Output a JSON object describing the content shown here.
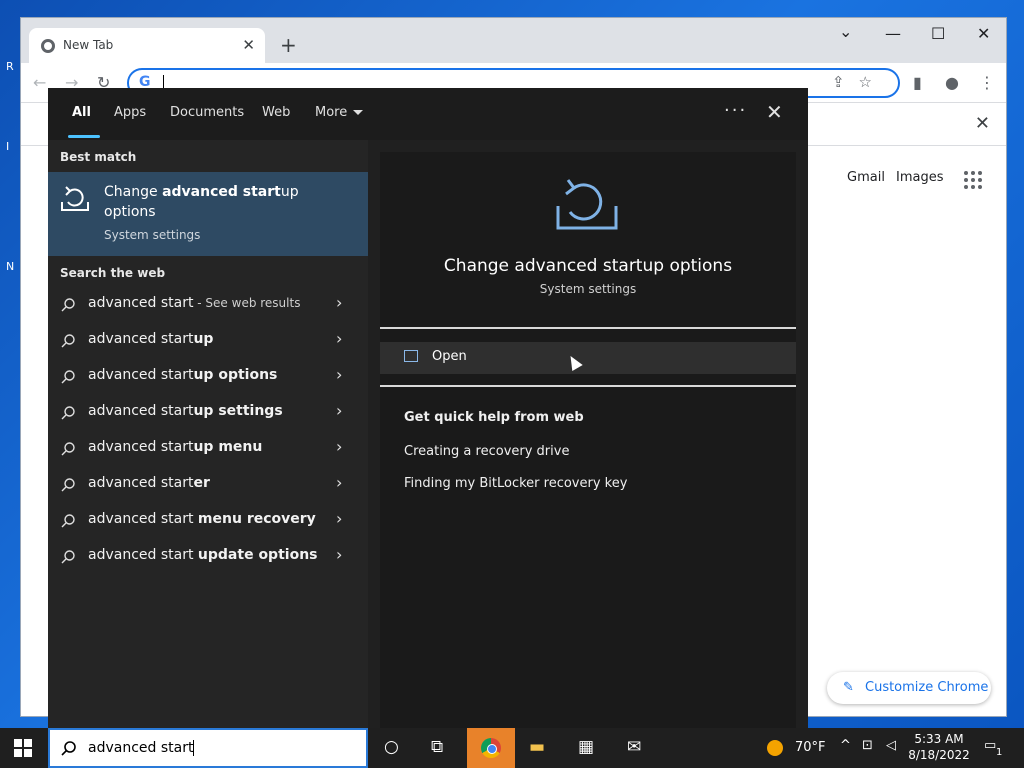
{
  "browser": {
    "tab_title": "New Tab",
    "new_tab_symbol": "+",
    "tab_close_symbol": "✕",
    "minimize_symbol": "—",
    "maximize_symbol": "☐",
    "close_symbol": "✕",
    "chevron_symbol": "⌄",
    "omnibox_g": "G",
    "page_links": [
      "Gmail",
      "Images"
    ],
    "customize_label": "Customize Chrome"
  },
  "search": {
    "tabs": [
      "All",
      "Apps",
      "Documents",
      "Web",
      "More"
    ],
    "dots": "···",
    "close": "✕",
    "best_match_label": "Best match",
    "best_match": {
      "title_pre": "Change ",
      "title_bold1": "advanced start",
      "title_post": "up options",
      "subtitle": "System settings"
    },
    "search_web_label": "Search the web",
    "web_results": [
      {
        "plain": "advanced start",
        "bold": "",
        "hint": " - See web results"
      },
      {
        "plain": "advanced start",
        "bold": "up",
        "hint": ""
      },
      {
        "plain": "advanced start",
        "bold": "up options",
        "hint": ""
      },
      {
        "plain": "advanced start",
        "bold": "up settings",
        "hint": ""
      },
      {
        "plain": "advanced start",
        "bold": "up menu",
        "hint": ""
      },
      {
        "plain": "advanced start",
        "bold": "er",
        "hint": ""
      },
      {
        "plain": "advanced start ",
        "bold": "menu recovery",
        "hint": ""
      },
      {
        "plain": "advanced start ",
        "bold": "update options",
        "hint": ""
      }
    ],
    "preview": {
      "title": "Change advanced startup options",
      "subtitle": "System settings",
      "open_label": "Open",
      "quick_help_title": "Get quick help from web",
      "links": [
        "Creating a recovery drive",
        "Finding my BitLocker recovery key"
      ]
    },
    "query": "advanced start"
  },
  "taskbar": {
    "weather": "70°F",
    "time": "5:33 AM",
    "date": "8/18/2022",
    "notification_count": "1"
  },
  "colors": {
    "accent": "#4cc2ff",
    "best_match_bg": "#2e4a63",
    "chrome_active": "#e8822a"
  }
}
